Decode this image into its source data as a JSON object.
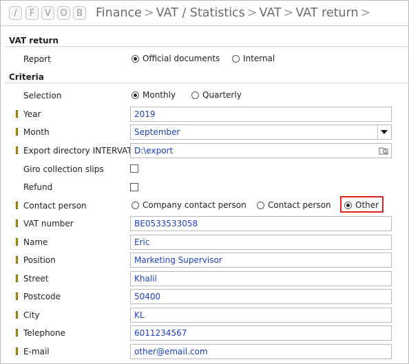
{
  "toolbar": {
    "buttons": [
      "/",
      "F",
      "V",
      "O",
      "B"
    ]
  },
  "breadcrumb": [
    "Finance",
    "VAT / Statistics",
    "VAT",
    "VAT return"
  ],
  "breadcrumb_separator": ">",
  "sections": {
    "vat_return": "VAT return",
    "criteria": "Criteria"
  },
  "report": {
    "label": "Report",
    "options": [
      "Official documents",
      "Internal"
    ],
    "selected": "Official documents"
  },
  "selection": {
    "label": "Selection",
    "options": [
      "Monthly",
      "Quarterly"
    ],
    "selected": "Monthly"
  },
  "fields": {
    "year": {
      "label": "Year",
      "value": "2019"
    },
    "month": {
      "label": "Month",
      "value": "September"
    },
    "export_dir": {
      "label": "Export directory INTERVAT",
      "value": "D:\\export"
    },
    "giro": {
      "label": "Giro collection slips",
      "checked": false
    },
    "refund": {
      "label": "Refund",
      "checked": false
    },
    "vat_number": {
      "label": "VAT number",
      "value": "BE0533533058"
    },
    "name": {
      "label": "Name",
      "value": "Eric"
    },
    "position": {
      "label": "Position",
      "value": "Marketing Supervisor"
    },
    "street": {
      "label": "Street",
      "value": "Khalil"
    },
    "postcode": {
      "label": "Postcode",
      "value": "50400"
    },
    "city": {
      "label": "City",
      "value": "KL"
    },
    "telephone": {
      "label": "Telephone",
      "value": "6011234567"
    },
    "email": {
      "label": "E-mail",
      "value": "other@email.com"
    }
  },
  "contact_person": {
    "label": "Contact person",
    "options": [
      "Company contact person",
      "Contact person",
      "Other"
    ],
    "selected": "Other"
  },
  "colors": {
    "value_text": "#1c3fc8",
    "highlight": "#e0201c",
    "required_marker": "#d6b100"
  }
}
